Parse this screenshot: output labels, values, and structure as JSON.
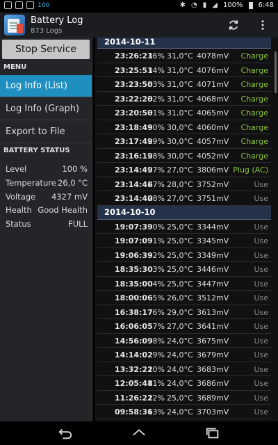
{
  "status_bar": {
    "notif_count": "100",
    "battery_pct": "100%",
    "time": "6:48"
  },
  "action_bar": {
    "title": "Battery Log",
    "subtitle": "873 Logs",
    "icons": [
      "refresh-icon",
      "overflow-menu-icon"
    ]
  },
  "sidebar": {
    "stop_button": "Stop Service",
    "menu_header": "MENU",
    "menu_items": [
      {
        "label": "Log Info (List)",
        "active": true
      },
      {
        "label": "Log Info (Graph)",
        "active": false
      },
      {
        "label": "Export to File",
        "active": false
      }
    ],
    "status_header": "BATTERY STATUS",
    "status": [
      {
        "key": "Level",
        "value": "100 %"
      },
      {
        "key": "Temperature",
        "value": "26,0 °C"
      },
      {
        "key": "Voltage",
        "value": "4327 mV"
      },
      {
        "key": "Health",
        "value": "Good Health"
      },
      {
        "key": "Status",
        "value": "FULL"
      }
    ]
  },
  "log": {
    "groups": [
      {
        "date": "2014-10-11",
        "rows": [
          {
            "time": "23:26:21",
            "level": "36%",
            "temp": "31,0°C",
            "volt": "4078mV",
            "status": "Charge"
          },
          {
            "time": "23:25:51",
            "level": "34%",
            "temp": "31,0°C",
            "volt": "4076mV",
            "status": "Charge"
          },
          {
            "time": "23:23:50",
            "level": "33%",
            "temp": "31,0°C",
            "volt": "4071mV",
            "status": "Charge"
          },
          {
            "time": "23:22:20",
            "level": "32%",
            "temp": "31,0°C",
            "volt": "4068mV",
            "status": "Charge"
          },
          {
            "time": "23:20:50",
            "level": "31%",
            "temp": "31,0°C",
            "volt": "4065mV",
            "status": "Charge"
          },
          {
            "time": "23:18:49",
            "level": "30%",
            "temp": "30,0°C",
            "volt": "4060mV",
            "status": "Charge"
          },
          {
            "time": "23:17:49",
            "level": "29%",
            "temp": "30,0°C",
            "volt": "4057mV",
            "status": "Charge"
          },
          {
            "time": "23:16:19",
            "level": "28%",
            "temp": "30,0°C",
            "volt": "4052mV",
            "status": "Charge"
          },
          {
            "time": "23:14:49",
            "level": "27%",
            "temp": "27,0°C",
            "volt": "3806mV",
            "status": "Plug (AC)"
          },
          {
            "time": "23:14:46",
            "level": "27%",
            "temp": "28,0°C",
            "volt": "3752mV",
            "status": "Use"
          },
          {
            "time": "23:14:40",
            "level": "28%",
            "temp": "27,0°C",
            "volt": "3751mV",
            "status": "Use"
          }
        ]
      },
      {
        "date": "2014-10-10",
        "rows": [
          {
            "time": "19:07:39",
            "level": "0%",
            "temp": "25,0°C",
            "volt": "3344mV",
            "status": "Use"
          },
          {
            "time": "19:07:09",
            "level": "1%",
            "temp": "25,0°C",
            "volt": "3345mV",
            "status": "Use"
          },
          {
            "time": "19:06:39",
            "level": "2%",
            "temp": "25,0°C",
            "volt": "3349mV",
            "status": "Use"
          },
          {
            "time": "18:35:30",
            "level": "3%",
            "temp": "25,0°C",
            "volt": "3446mV",
            "status": "Use"
          },
          {
            "time": "18:35:00",
            "level": "4%",
            "temp": "25,0°C",
            "volt": "3447mV",
            "status": "Use"
          },
          {
            "time": "18:00:06",
            "level": "5%",
            "temp": "26,0°C",
            "volt": "3512mV",
            "status": "Use"
          },
          {
            "time": "16:38:17",
            "level": "6%",
            "temp": "29,0°C",
            "volt": "3613mV",
            "status": "Use"
          },
          {
            "time": "16:06:05",
            "level": "7%",
            "temp": "27,0°C",
            "volt": "3641mV",
            "status": "Use"
          },
          {
            "time": "14:56:09",
            "level": "8%",
            "temp": "24,0°C",
            "volt": "3675mV",
            "status": "Use"
          },
          {
            "time": "14:14:02",
            "level": "9%",
            "temp": "24,0°C",
            "volt": "3679mV",
            "status": "Use"
          },
          {
            "time": "13:32:22",
            "level": "10%",
            "temp": "24,0°C",
            "volt": "3683mV",
            "status": "Use"
          },
          {
            "time": "12:05:48",
            "level": "11%",
            "temp": "24,0°C",
            "volt": "3686mV",
            "status": "Use"
          },
          {
            "time": "11:26:22",
            "level": "12%",
            "temp": "25,0°C",
            "volt": "3689mV",
            "status": "Use"
          },
          {
            "time": "09:58:36",
            "level": "13%",
            "temp": "24,0°C",
            "volt": "3703mV",
            "status": "Use"
          }
        ]
      }
    ]
  },
  "colors": {
    "accent": "#1f8fc0",
    "charge": "#8dc63f",
    "use": "#8c8c8c",
    "date_header": "#24324a"
  },
  "nav_bar": {
    "icons": [
      "back-icon",
      "home-icon",
      "recent-apps-icon"
    ]
  }
}
